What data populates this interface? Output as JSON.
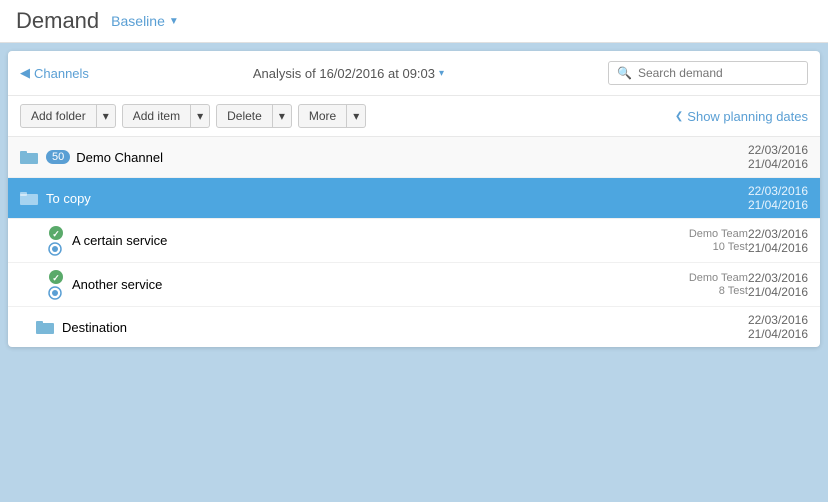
{
  "header": {
    "title": "Demand",
    "baseline_label": "Baseline",
    "baseline_arrow": "▼"
  },
  "nav": {
    "channels_label": "Channels",
    "analysis_label": "Analysis of 16/02/2016 at 09:03",
    "analysis_arrow": "▾",
    "search_placeholder": "Search demand"
  },
  "toolbar": {
    "add_folder_label": "Add folder",
    "add_item_label": "Add item",
    "delete_label": "Delete",
    "more_label": "More",
    "show_planning_label": "Show planning dates"
  },
  "rows": [
    {
      "type": "channel",
      "icon": "folder",
      "badge": "50",
      "label": "Demo Channel",
      "date1": "22/03/2016",
      "date2": "21/04/2016"
    },
    {
      "type": "folder-selected",
      "icon": "folder",
      "label": "To copy",
      "date1": "22/03/2016",
      "date2": "21/04/2016"
    },
    {
      "type": "service",
      "label": "A certain service",
      "team": "Demo Team",
      "count": "10 Test",
      "date1": "22/03/2016",
      "date2": "21/04/2016"
    },
    {
      "type": "service",
      "label": "Another service",
      "team": "Demo Team",
      "count": "8 Test",
      "date1": "22/03/2016",
      "date2": "21/04/2016"
    },
    {
      "type": "folder",
      "icon": "folder",
      "label": "Destination",
      "date1": "22/03/2016",
      "date2": "21/04/2016"
    }
  ],
  "colors": {
    "selected_bg": "#4da6e0",
    "link_color": "#5a9fd4",
    "folder_color": "#7ab8d8",
    "service_color": "#5aaa6a"
  }
}
